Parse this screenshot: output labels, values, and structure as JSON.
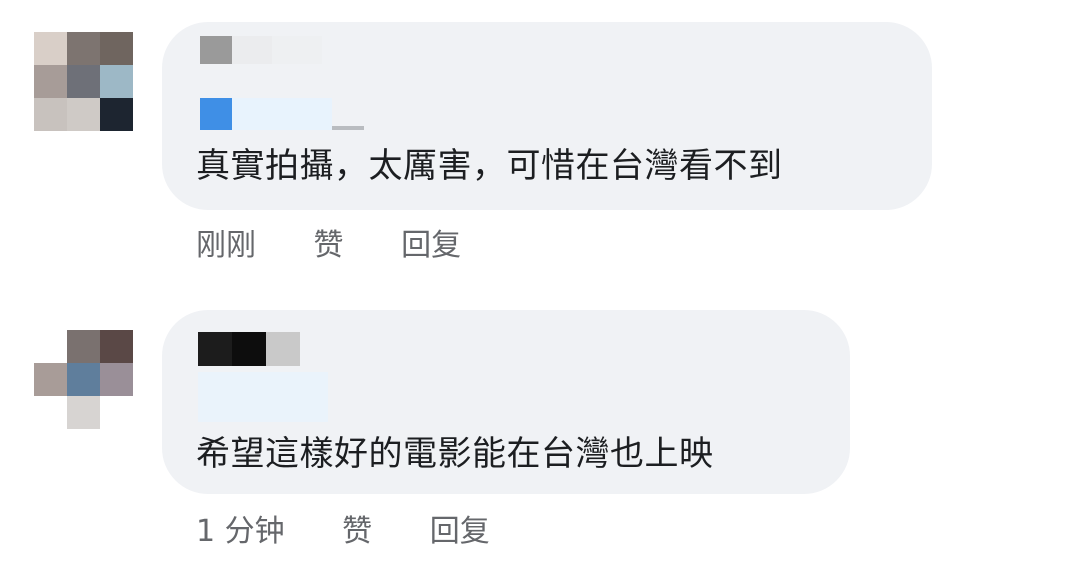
{
  "comments": [
    {
      "text": "真實拍攝，太厲害，可惜在台灣看不到",
      "time": "刚刚",
      "like_label": "赞",
      "reply_label": "回复"
    },
    {
      "text": "希望這樣好的電影能在台灣也上映",
      "time": "1 分钟",
      "like_label": "赞",
      "reply_label": "回复"
    }
  ],
  "colors": {
    "bubble": "#f0f2f5",
    "text": "#1c1e21",
    "meta": "#65676b"
  }
}
